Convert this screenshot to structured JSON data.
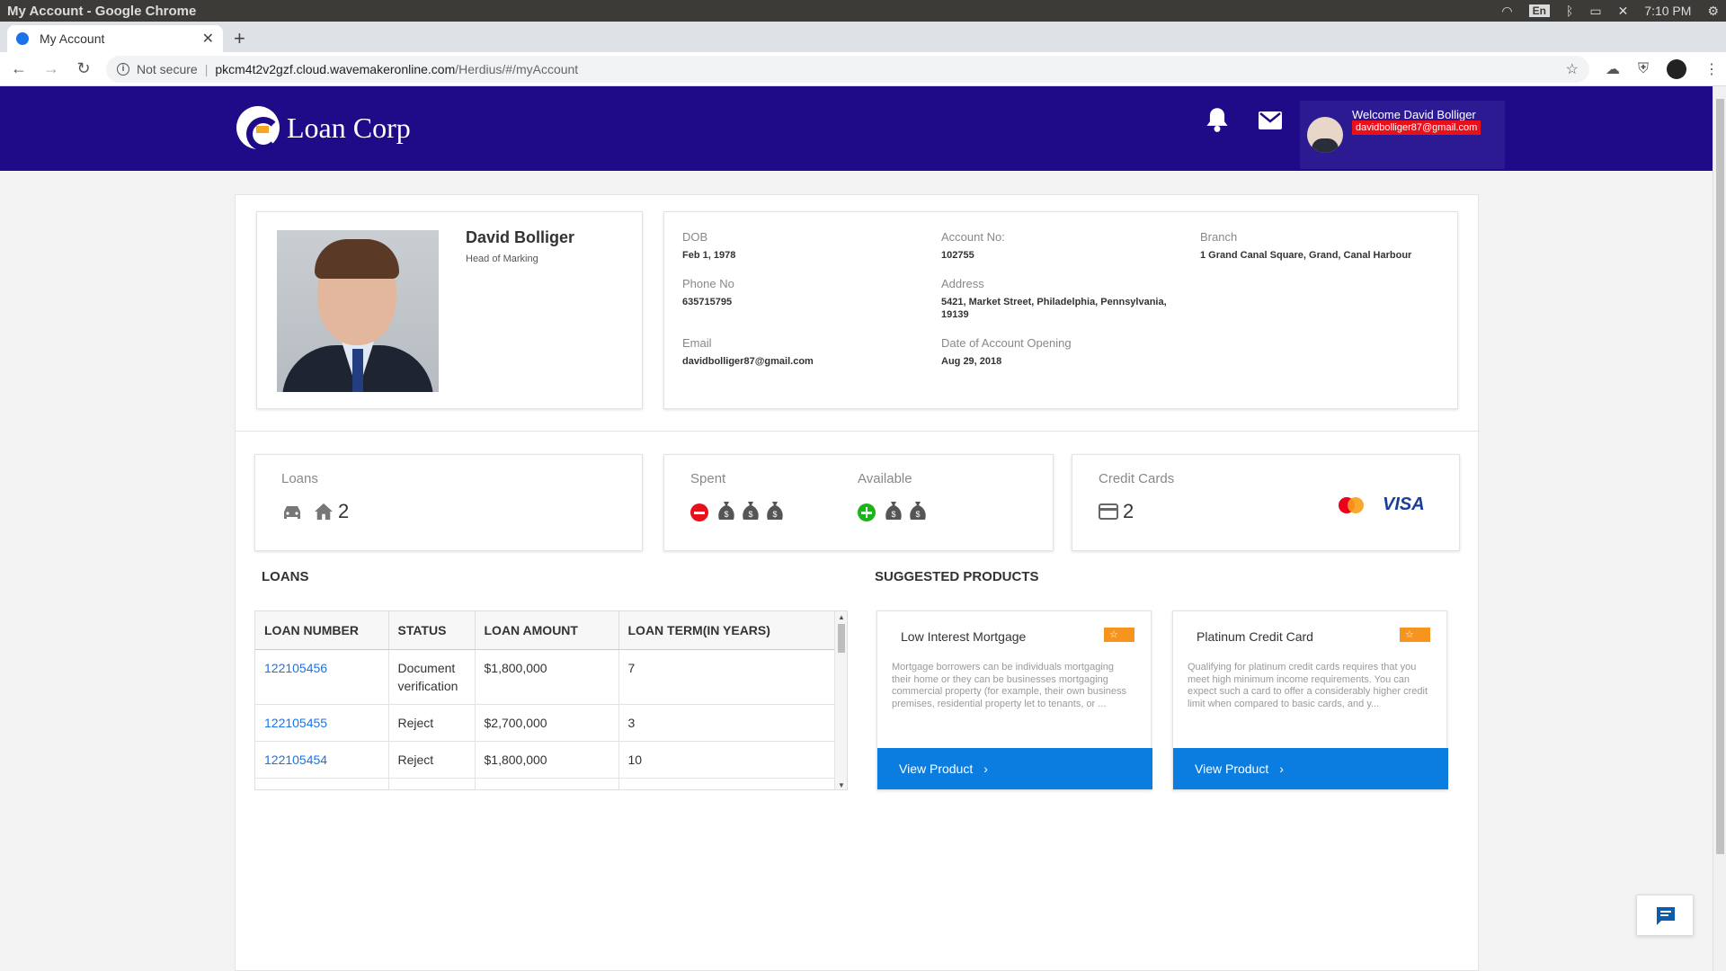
{
  "os": {
    "window_title": "My Account - Google Chrome",
    "lang": "En",
    "time": "7:10 PM"
  },
  "browser": {
    "tab_title": "My Account",
    "security": "Not secure",
    "url_host": "pkcm4t2v2gzf.cloud.wavemakeronline.com",
    "url_path": "/Herdius/#/myAccount"
  },
  "header": {
    "logo_text": "Loan Corp",
    "welcome": "Welcome David Bolliger",
    "email_tag": "davidbolliger87@gmail.com"
  },
  "profile": {
    "name": "David Bolliger",
    "role": "Head of Marking"
  },
  "details": {
    "dob_label": "DOB",
    "dob": "Feb 1, 1978",
    "account_label": "Account No:",
    "account": "102755",
    "branch_label": "Branch",
    "branch": "1 Grand Canal Square, Grand, Canal Harbour",
    "phone_label": "Phone No",
    "phone": "635715795",
    "address_label": "Address",
    "address_line1": "5421, Market Street, Philadelphia, Pennsylvania,",
    "address_line2": "19139",
    "email_label": "Email",
    "email": "davidbolliger87@gmail.com",
    "opening_label": "Date of Account Opening",
    "opening": "Aug 29, 2018"
  },
  "stats": {
    "loans_label": "Loans",
    "loans_count": "2",
    "spent_label": "Spent",
    "available_label": "Available",
    "cards_label": "Credit Cards",
    "cards_count": "2",
    "visa_text": "VISA"
  },
  "colors": {
    "header_bg": "#1f0a88",
    "accent_blue": "#0b7de0",
    "spent_red": "#e8101a",
    "available_green": "#1cb31c",
    "star_orange": "#f7941d"
  },
  "loans": {
    "title": "LOANS",
    "columns": [
      "LOAN NUMBER",
      "STATUS",
      "LOAN AMOUNT",
      "LOAN TERM(IN YEARS)"
    ],
    "rows": [
      {
        "number": "122105456",
        "status": "Document verification",
        "amount": "$1,800,000",
        "term": "7"
      },
      {
        "number": "122105455",
        "status": "Reject",
        "amount": "$2,700,000",
        "term": "3"
      },
      {
        "number": "122105454",
        "status": "Reject",
        "amount": "$1,800,000",
        "term": "10"
      }
    ]
  },
  "products": {
    "title": "SUGGESTED PRODUCTS",
    "items": [
      {
        "name": "Low Interest Mortgage",
        "description": "Mortgage borrowers can be individuals mortgaging their home or they can be businesses mortgaging commercial property (for example, their own business premises, residential property let to tenants, or ...",
        "button": "View Product"
      },
      {
        "name": "Platinum Credit Card",
        "description": "Qualifying for platinum credit cards requires that you meet high minimum income requirements. You can expect such a card to offer a considerably higher credit limit when compared to basic cards, and y...",
        "button": "View Product"
      }
    ]
  }
}
